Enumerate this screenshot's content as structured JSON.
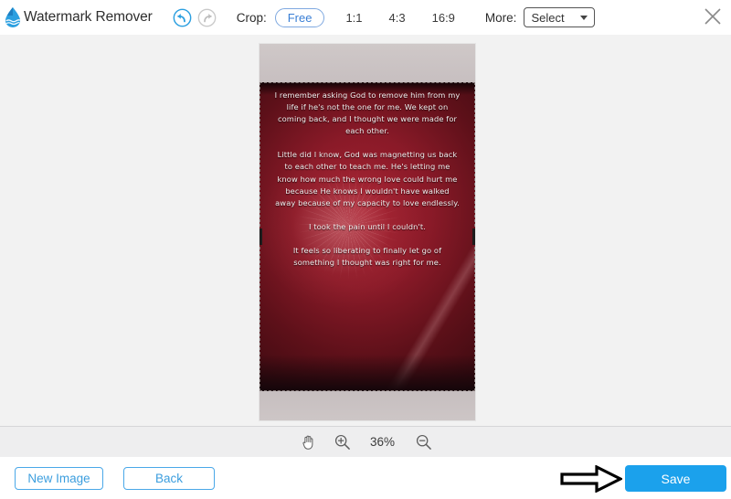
{
  "app": {
    "title": "Watermark Remover",
    "logo_icon": "water-drop-icon",
    "accent_color": "#1ba1ec",
    "outline_color": "#4aa8e8"
  },
  "header": {
    "undo_icon": "undo-arrow-icon",
    "redo_icon": "redo-arrow-icon",
    "crop_label": "Crop:",
    "ratios": [
      {
        "label": "Free",
        "selected": true
      },
      {
        "label": "1:1",
        "selected": false
      },
      {
        "label": "4:3",
        "selected": false
      },
      {
        "label": "16:9",
        "selected": false
      }
    ],
    "more_label": "More:",
    "select_value": "Select",
    "select_caret_icon": "chevron-down-icon",
    "close_icon": "close-icon"
  },
  "canvas": {
    "image_alt": "red fireworks background with quote text",
    "crop_active": true
  },
  "image_text": {
    "paragraphs": [
      "I remember asking God to remove him from my life if he's not the one for me. We kept on coming back, and I thought we were made for each other.",
      "Little did I know, God was magnetting us back to each other to teach me. He's letting me know how much the wrong love could hurt me because He knows I wouldn't have walked away because of my capacity to love endlessly.",
      "I took the pain until I couldn't.",
      "It feels so liberating to finally let go of something I thought was right for me."
    ]
  },
  "zoombar": {
    "hand_icon": "hand-tool-icon",
    "zoom_in_icon": "zoom-in-icon",
    "zoom_level": "36%",
    "zoom_out_icon": "zoom-out-icon"
  },
  "footer": {
    "new_image_label": "New Image",
    "back_label": "Back",
    "save_label": "Save",
    "annotation_icon": "right-arrow-annotation-icon"
  }
}
